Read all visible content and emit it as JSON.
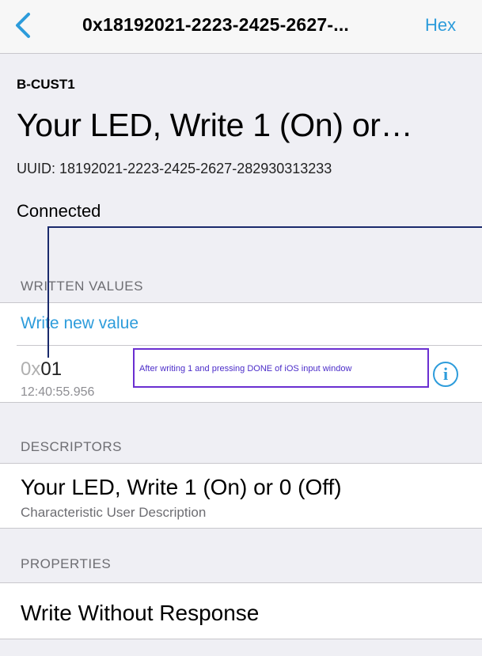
{
  "nav": {
    "title": "0x18192021-2223-2425-2627-...",
    "hex_label": "Hex"
  },
  "header": {
    "service_name": "B-CUST1",
    "characteristic_title": "Your LED, Write 1 (On) or…",
    "uuid": "UUID: 18192021-2223-2425-2627-282930313233",
    "status": "Connected"
  },
  "written_values": {
    "section_title": "WRITTEN VALUES",
    "write_link": "Write new value",
    "entry": {
      "prefix": "0x",
      "value": "01",
      "timestamp": "12:40:55.956"
    }
  },
  "annotation": {
    "text": "After writing 1 and pressing DONE of iOS input window"
  },
  "descriptors": {
    "section_title": "DESCRIPTORS",
    "main": "Your LED, Write 1 (On) or 0 (Off)",
    "sub": "Characteristic User Description"
  },
  "properties": {
    "section_title": "PROPERTIES",
    "item": "Write Without Response"
  },
  "colors": {
    "accent": "#2d9cdb",
    "annotation": "#6a2fd1",
    "annotation_line": "#1a2a6c"
  },
  "icons": {
    "back": "chevron-left-icon",
    "info": "info-circle-icon"
  }
}
